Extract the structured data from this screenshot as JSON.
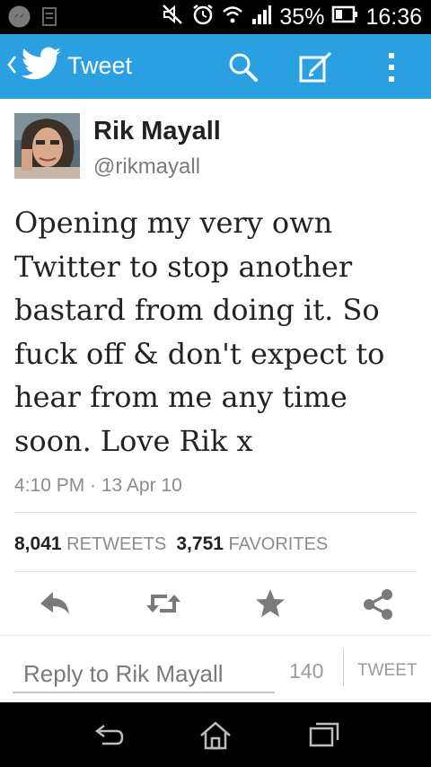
{
  "status_bar": {
    "battery_percent": "35%",
    "time": "16:36",
    "icons": [
      "messenger-icon",
      "notification-icon",
      "mute-icon",
      "alarm-icon",
      "wifi-icon",
      "signal-icon",
      "battery-icon"
    ]
  },
  "header": {
    "title": "Tweet",
    "icons": [
      "back-arrow-icon",
      "twitter-bird-icon",
      "search-icon",
      "compose-icon",
      "overflow-menu-icon"
    ]
  },
  "tweet": {
    "author_name": "Rik Mayall",
    "author_handle": "@rikmayall",
    "text": "Opening my very own Twitter to stop another bastard from doing it. So fuck off & don't expect to hear from me any time soon. Love Rik x",
    "timestamp": "4:10 PM · 13 Apr 10",
    "retweets_count": "8,041",
    "retweets_label": "RETWEETS",
    "favorites_count": "3,751",
    "favorites_label": "FAVORITES"
  },
  "actions": {
    "icons": [
      "reply-icon",
      "retweet-icon",
      "favorite-icon",
      "share-icon"
    ]
  },
  "reply_bar": {
    "placeholder": "Reply to Rik Mayall",
    "char_count": "140",
    "button_label": "TWEET"
  },
  "nav_bar": {
    "icons": [
      "back-icon",
      "home-icon",
      "recents-icon"
    ]
  },
  "colors": {
    "action_bar": "#2aa0e0",
    "status_bar": "#000000",
    "text": "#222222",
    "secondary_text": "#8c8c8c"
  }
}
